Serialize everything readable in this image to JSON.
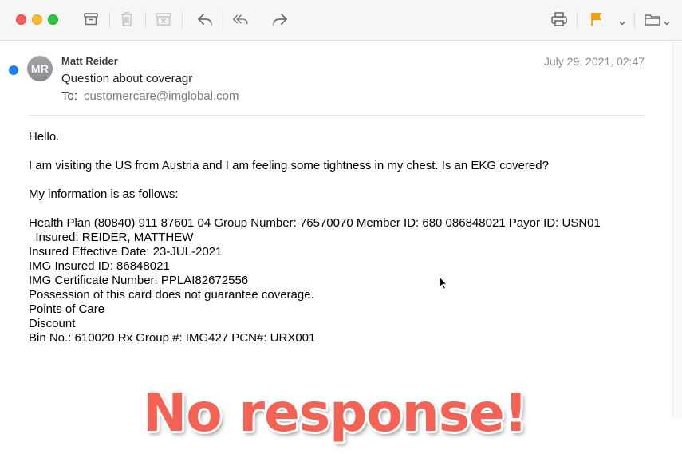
{
  "toolbar": {
    "icons": [
      "archive-icon",
      "trash-icon",
      "junk-icon",
      "reply-icon",
      "reply-all-icon",
      "forward-icon",
      "print-icon",
      "flag-icon",
      "move-to-folder-icon"
    ],
    "flag_color": "#f5a00a"
  },
  "message": {
    "unread": true,
    "avatar_initials": "MR",
    "sender": "Matt Reider",
    "subject": "Question about coveragr",
    "to_label": "To:",
    "to_address": "customercare@imglobal.com",
    "date": "July 29, 2021, 02:47",
    "body": {
      "greeting": "Hello.",
      "paragraph1": "I am visiting the US from Austria and I am feeling some tightness in my chest. Is an EKG covered?",
      "paragraph2": "My information is as follows:",
      "lines": [
        "Health Plan (80840) 911 87601 04 Group Number: 76570070 Member ID: 680 086848021 Payor ID: USN01",
        "  Insured: REIDER, MATTHEW",
        "Insured Effective Date: 23-JUL-2021",
        "IMG Insured ID: 86848021",
        "IMG Certificate Number: PPLAI82672556",
        "Possession of this card does not guarantee coverage.",
        "Points of Care",
        "Discount",
        "Bin No.: 610020 Rx Group #: IMG427 PCN#: URX001"
      ]
    }
  },
  "overlay": {
    "text": "No response!",
    "color": "#f46155"
  }
}
